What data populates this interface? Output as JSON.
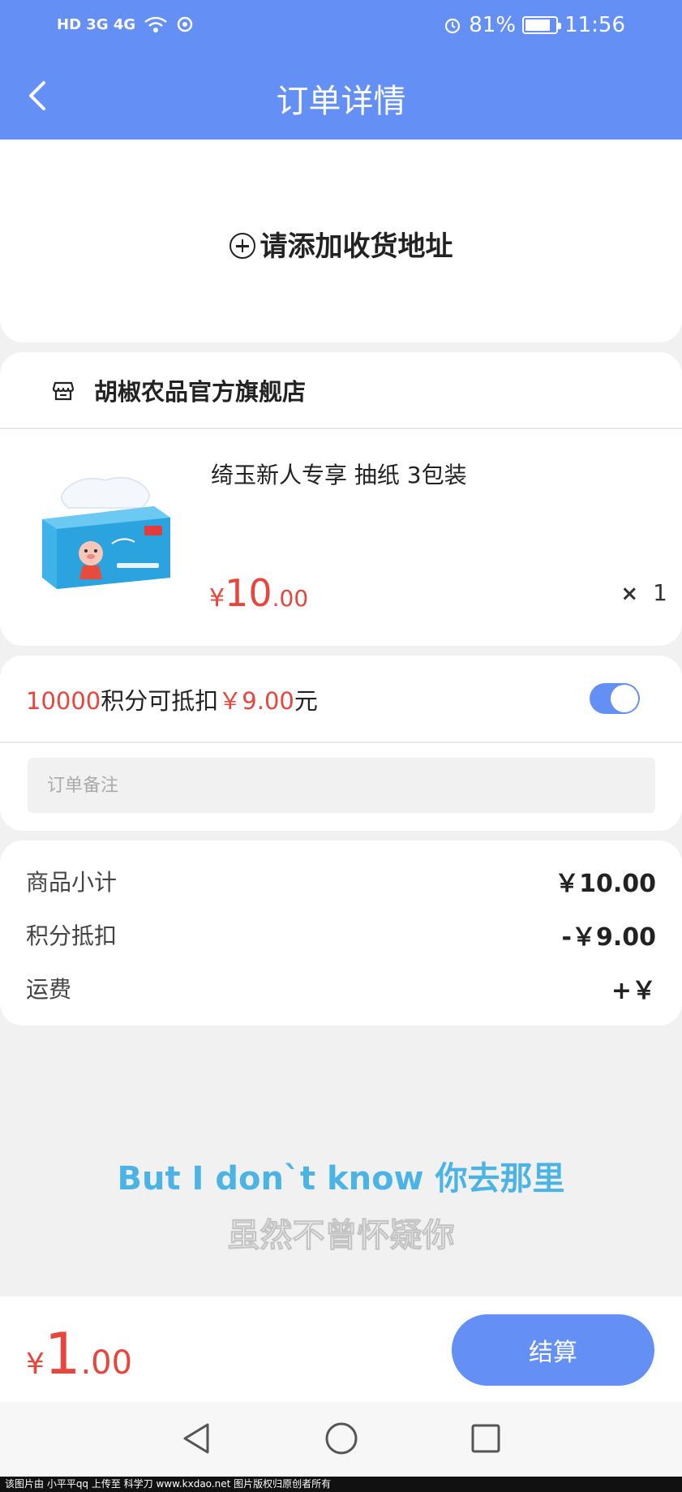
{
  "status_bar": {
    "network": "HD 3G 4G",
    "battery": "81%",
    "time": "11:56"
  },
  "header": {
    "title": "订单详情"
  },
  "address": {
    "add_label": "请添加收货地址"
  },
  "shop": {
    "name": "胡椒农品官方旗舰店",
    "product": {
      "name": "绮玉新人专享 抽纸 3包装",
      "price_symbol": "¥",
      "price_int": "10",
      "price_dec": ".00",
      "qty_symbol": "×",
      "qty": "1"
    }
  },
  "points": {
    "amount": "10000",
    "text_mid": "积分可抵扣",
    "deduct": "￥9.00",
    "suffix": "元",
    "enabled": true
  },
  "remark": {
    "placeholder": "订单备注"
  },
  "summary": {
    "subtotal_label": "商品小计",
    "subtotal_value": "￥10.00",
    "points_label": "积分抵扣",
    "points_value": "-￥9.00",
    "shipping_label": "运费",
    "shipping_value": "+￥"
  },
  "overlay": {
    "lyric_line1": "But I don`t know 你去那里",
    "lyric_line2": "虽然不曾怀疑你"
  },
  "footer": {
    "total_symbol": "¥",
    "total_int": "1",
    "total_dec": ".00",
    "checkout_label": "结算"
  },
  "watermark": "该图片由 小平平qq 上传至 科学刀 www.kxdao.net 图片版权归原创者所有",
  "colors": {
    "accent": "#6490f5",
    "price": "#e8453c"
  }
}
